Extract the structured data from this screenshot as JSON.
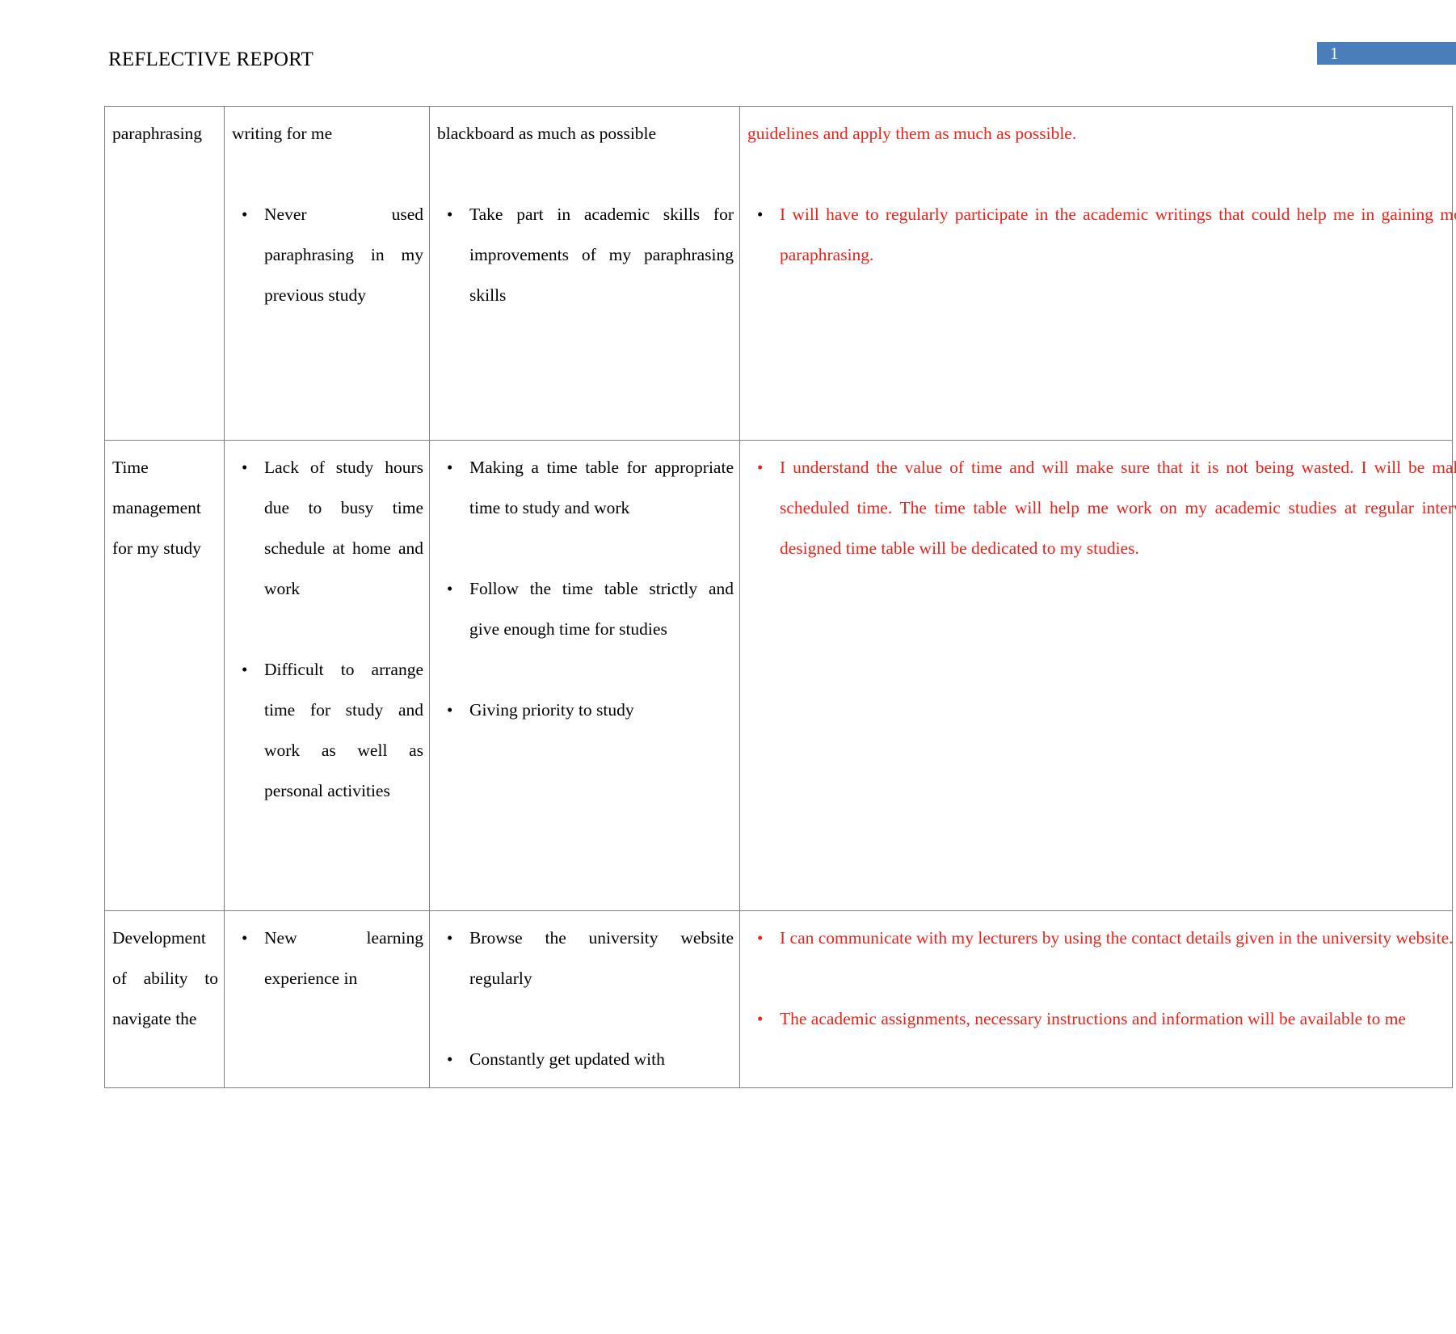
{
  "header": {
    "title": "REFLECTIVE REPORT",
    "page_number": "1",
    "badge_color": "#4a7ebb"
  },
  "colors": {
    "red_text": "#e8241c",
    "black_text": "#000000",
    "table_border": "#808080"
  },
  "table": {
    "rows": [
      {
        "label": "paraphrasing",
        "issues": {
          "continuation": "writing for me",
          "bullets": [
            "Never used paraphrasing in my previous study"
          ]
        },
        "actions": {
          "continuation": "blackboard as much as possible",
          "bullets": [
            "Take part in academic skills for improvements of my paraphrasing skills"
          ]
        },
        "reflection": {
          "continuation": "guidelines and apply them as much as possible.",
          "bullet_color": "#000000",
          "bullets": [
            "I will have to regularly participate in the academic writings that could help me in gaining more knowledge about paraphrasing."
          ]
        }
      },
      {
        "label": "Time management for my study",
        "issues": {
          "continuation": "",
          "bullets": [
            "Lack of study hours due to busy time schedule at home and work",
            "Difficult to arrange time for study and work as well as personal activities"
          ]
        },
        "actions": {
          "continuation": "",
          "bullets": [
            "Making a time table for appropriate time to study and work",
            "Follow the time table strictly and give enough time for studies",
            "Giving priority to study"
          ]
        },
        "reflection": {
          "continuation": "",
          "bullet_color": "#e8241c",
          "bullets": [
            "I understand the value of time and will make sure that it is not being wasted. I will be making effective use of scheduled time. The time table will help me work on my academic studies at regular interval.Most time in the designed time table will be dedicated to my studies."
          ]
        }
      },
      {
        "label": "Development of ability to navigate the",
        "issues": {
          "continuation": "",
          "bullets": [
            "New learning experience in"
          ]
        },
        "actions": {
          "continuation": "",
          "bullets": [
            "Browse the university website regularly",
            "Constantly get updated with"
          ]
        },
        "reflection": {
          "continuation": "",
          "bullet_color": "#e8241c",
          "bullets": [
            "I can communicate with my lecturers by using the contact details given in the university website.",
            "The academic assignments, necessary instructions and information will be available to me"
          ]
        }
      }
    ]
  }
}
